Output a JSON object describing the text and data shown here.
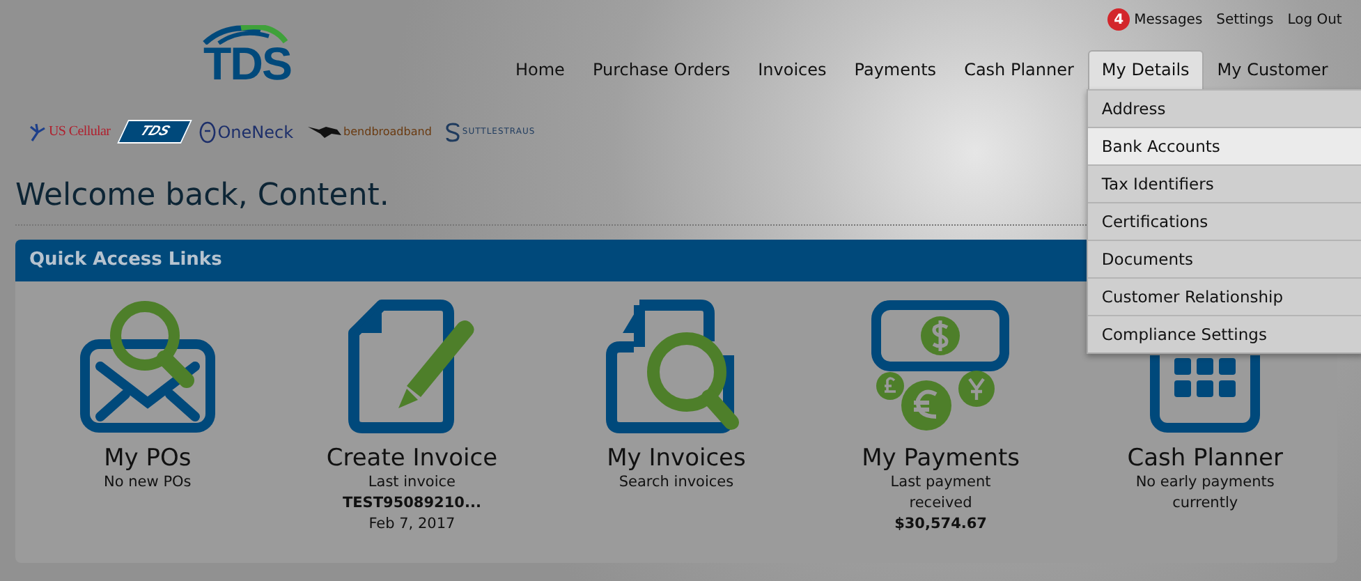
{
  "utility_links": {
    "message_count": "4",
    "links": [
      "Messages",
      "Settings",
      "Log Out"
    ]
  },
  "logo": {
    "text": "TDS"
  },
  "partners": [
    {
      "kind": "uscellular",
      "text": "US Cellular"
    },
    {
      "kind": "tds",
      "text": "TDS"
    },
    {
      "kind": "oneneck",
      "text": "OneNeck"
    },
    {
      "kind": "bend",
      "text": "bendbroadband"
    },
    {
      "kind": "suttle",
      "text": "SUTTLESTRAUS"
    }
  ],
  "nav": [
    {
      "label": "Home",
      "selected": false
    },
    {
      "label": "Purchase Orders",
      "selected": false
    },
    {
      "label": "Invoices",
      "selected": false
    },
    {
      "label": "Payments",
      "selected": false
    },
    {
      "label": "Cash Planner",
      "selected": false
    },
    {
      "label": "My Details",
      "selected": true
    },
    {
      "label": "My Customer",
      "selected": false
    }
  ],
  "dropdown": [
    {
      "label": "Address",
      "selected": false
    },
    {
      "label": "Bank Accounts",
      "selected": true
    },
    {
      "label": "Tax Identifiers",
      "selected": false
    },
    {
      "label": "Certifications",
      "selected": false
    },
    {
      "label": "Documents",
      "selected": false
    },
    {
      "label": "Customer Relationship",
      "selected": false
    },
    {
      "label": "Compliance Settings",
      "selected": false
    }
  ],
  "welcome": "Welcome back, Content.",
  "quick_access": {
    "title": "Quick Access Links",
    "cards": [
      {
        "kind": "pos",
        "title": "My POs",
        "lines": [
          {
            "text": "No new POs",
            "bold": false
          }
        ]
      },
      {
        "kind": "create",
        "title": "Create Invoice",
        "lines": [
          {
            "text": "Last invoice",
            "bold": false
          },
          {
            "text": "TEST95089210...",
            "bold": true
          },
          {
            "text": "Feb 7, 2017",
            "bold": false
          }
        ]
      },
      {
        "kind": "invoices",
        "title": "My Invoices",
        "lines": [
          {
            "text": "Search invoices",
            "bold": false
          }
        ]
      },
      {
        "kind": "payments",
        "title": "My Payments",
        "lines": [
          {
            "text": "Last payment received",
            "bold": false
          },
          {
            "text": "$30,574.67",
            "bold": true
          }
        ]
      },
      {
        "kind": "planner",
        "title": "Cash Planner",
        "lines": [
          {
            "text": "No early payments currently",
            "bold": false
          }
        ]
      }
    ]
  }
}
